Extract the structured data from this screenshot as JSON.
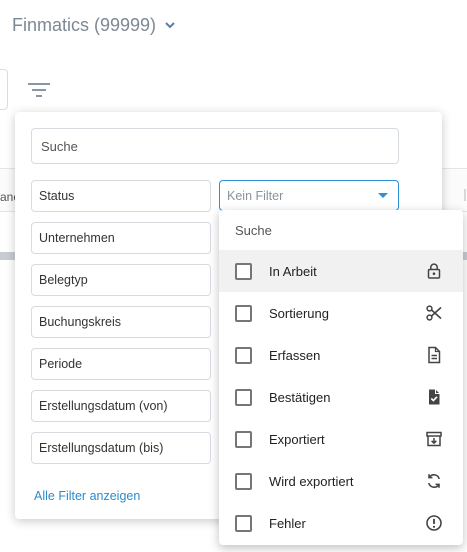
{
  "header": {
    "company_name": "Finmatics (99999)"
  },
  "background": {
    "truncated_text": "anc"
  },
  "filter_panel": {
    "search_placeholder": "Suche",
    "filters": [
      {
        "label": "Status"
      },
      {
        "label": "Unternehmen"
      },
      {
        "label": "Belegtyp"
      },
      {
        "label": "Buchungskreis"
      },
      {
        "label": "Periode"
      },
      {
        "label": "Erstellungsdatum (von)"
      },
      {
        "label": "Erstellungsdatum (bis)"
      }
    ],
    "status_select_value": "Kein Filter",
    "all_filters_link": "Alle Filter anzeigen"
  },
  "dropdown": {
    "search_placeholder": "Suche",
    "options": [
      {
        "label": "In Arbeit",
        "icon": "lock-icon",
        "checked": false
      },
      {
        "label": "Sortierung",
        "icon": "scissors-icon",
        "checked": false
      },
      {
        "label": "Erfassen",
        "icon": "document-icon",
        "checked": false
      },
      {
        "label": "Bestätigen",
        "icon": "document-check-icon",
        "checked": false
      },
      {
        "label": "Exportiert",
        "icon": "archive-icon",
        "checked": false
      },
      {
        "label": "Wird exportiert",
        "icon": "sync-icon",
        "checked": false
      },
      {
        "label": "Fehler",
        "icon": "error-icon",
        "checked": false
      }
    ]
  },
  "colors": {
    "accent": "#2d8fd5",
    "link": "#2a8ccd",
    "muted_text": "#7d8896"
  }
}
